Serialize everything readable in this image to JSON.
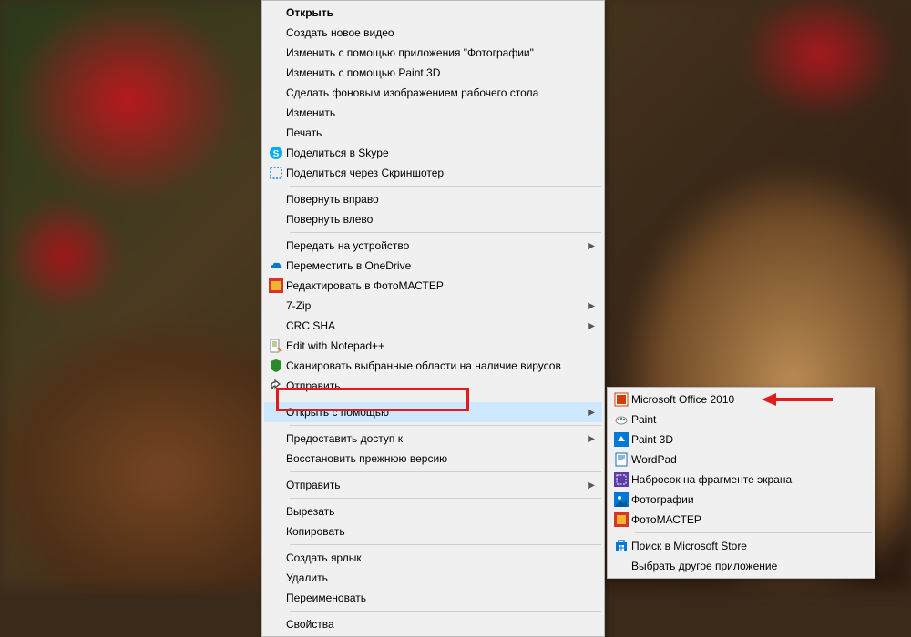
{
  "mainMenu": {
    "open": "Открыть",
    "createVideo": "Создать новое видео",
    "editPhotosApp": "Изменить с помощью приложения \"Фотографии\"",
    "editPaint3d": "Изменить с помощью Paint 3D",
    "setWallpaper": "Сделать фоновым изображением рабочего стола",
    "edit": "Изменить",
    "print": "Печать",
    "shareSkype": "Поделиться в Skype",
    "shareScreenshoter": "Поделиться через Скриншотер",
    "rotateRight": "Повернуть вправо",
    "rotateLeft": "Повернуть влево",
    "castDevice": "Передать на устройство",
    "moveOnedrive": "Переместить в OneDrive",
    "editFotomaster": "Редактировать в ФотоМАСТЕР",
    "sevenZip": "7-Zip",
    "crcSha": "CRC SHA",
    "editNotepadpp": "Edit with Notepad++",
    "scanVirus": "Сканировать выбранные области на наличие вирусов",
    "share": "Отправить",
    "openWith": "Открыть с помощью",
    "grantAccess": "Предоставить доступ к",
    "restorePrev": "Восстановить прежнюю версию",
    "sendTo": "Отправить",
    "cut": "Вырезать",
    "copy": "Копировать",
    "createShortcut": "Создать ярлык",
    "delete": "Удалить",
    "rename": "Переименовать",
    "properties": "Свойства"
  },
  "subMenu": {
    "msOffice": "Microsoft Office 2010",
    "paint": "Paint",
    "paint3d": "Paint 3D",
    "wordpad": "WordPad",
    "snipSketch": "Набросок на фрагменте экрана",
    "photos": "Фотографии",
    "fotomaster": "ФотоМАСТЕР",
    "msStore": "Поиск в Microsoft Store",
    "chooseOther": "Выбрать другое приложение"
  }
}
